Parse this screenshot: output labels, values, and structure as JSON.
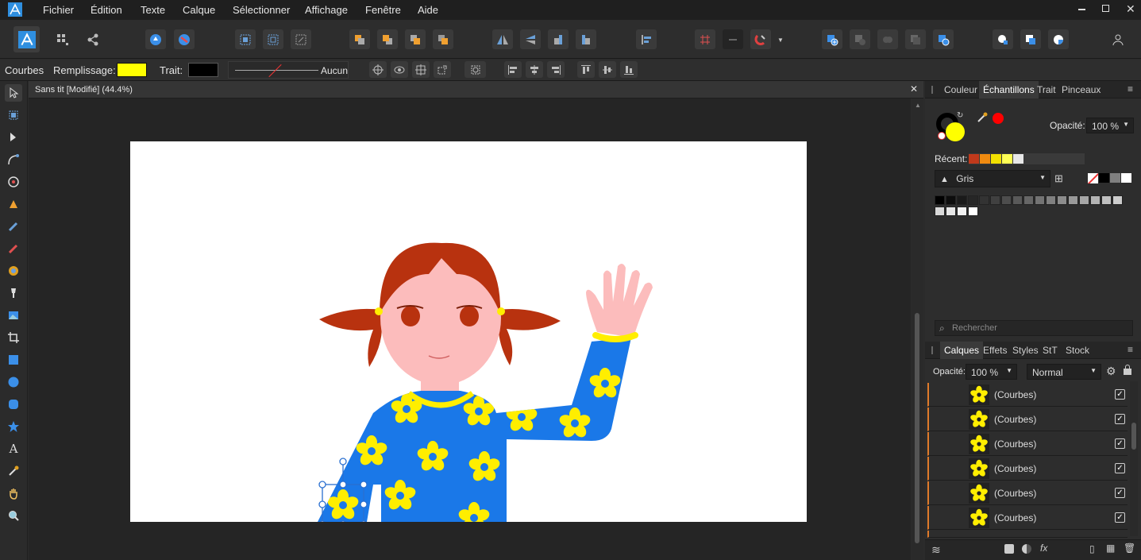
{
  "menubar": {
    "items": [
      "Fichier",
      "Édition",
      "Texte",
      "Calque",
      "Sélectionner",
      "Affichage",
      "Fenêtre",
      "Aide"
    ]
  },
  "context": {
    "object_type": "Courbes",
    "fill_label": "Remplissage:",
    "fill_color": "#ffff00",
    "stroke_label": "Trait:",
    "stroke_color": "#000000",
    "stroke_style": "Aucun"
  },
  "document": {
    "tab_title": "Sans tit [Modifié] (44.4%)"
  },
  "swatches_panel": {
    "tabs": [
      "Couleur",
      "Échantillons",
      "Trait",
      "Pinceaux"
    ],
    "active_tab": "Échantillons",
    "opacity_label": "Opacité:",
    "opacity_value": "100 %",
    "recent_label": "Récent:",
    "recent_colors": [
      "#c0391b",
      "#f08a10",
      "#f2e000",
      "#ffff55",
      "#e8e8e8"
    ],
    "palette_name": "Gris",
    "greys": [
      "#000000",
      "#0d0d0d",
      "#1a1a1a",
      "#262626",
      "#333333",
      "#404040",
      "#4d4d4d",
      "#595959",
      "#666666",
      "#737373",
      "#808080",
      "#8c8c8c",
      "#999999",
      "#a6a6a6",
      "#b3b3b3",
      "#bfbfbf",
      "#cccccc",
      "#d9d9d9",
      "#e6e6e6",
      "#f2f2f2",
      "#ffffff"
    ],
    "search_placeholder": "Rechercher"
  },
  "layers_panel": {
    "tabs": [
      "Calques",
      "Effets",
      "Styles",
      "StT",
      "Stock"
    ],
    "active_tab": "Calques",
    "opacity_label": "Opacité:",
    "opacity_value": "100 %",
    "blend_mode": "Normal",
    "layers": [
      {
        "name": "(Courbes)"
      },
      {
        "name": "(Courbes)"
      },
      {
        "name": "(Courbes)"
      },
      {
        "name": "(Courbes)"
      },
      {
        "name": "(Courbes)"
      },
      {
        "name": "(Courbes)"
      }
    ]
  },
  "colors": {
    "accent_blue": "#2f8fe0",
    "shirt_blue": "#1a78e8",
    "flower_yellow": "#ffee00",
    "hair_red": "#b8320f",
    "skin": "#fcbcbc",
    "layer_marker": "#e07a2a"
  }
}
